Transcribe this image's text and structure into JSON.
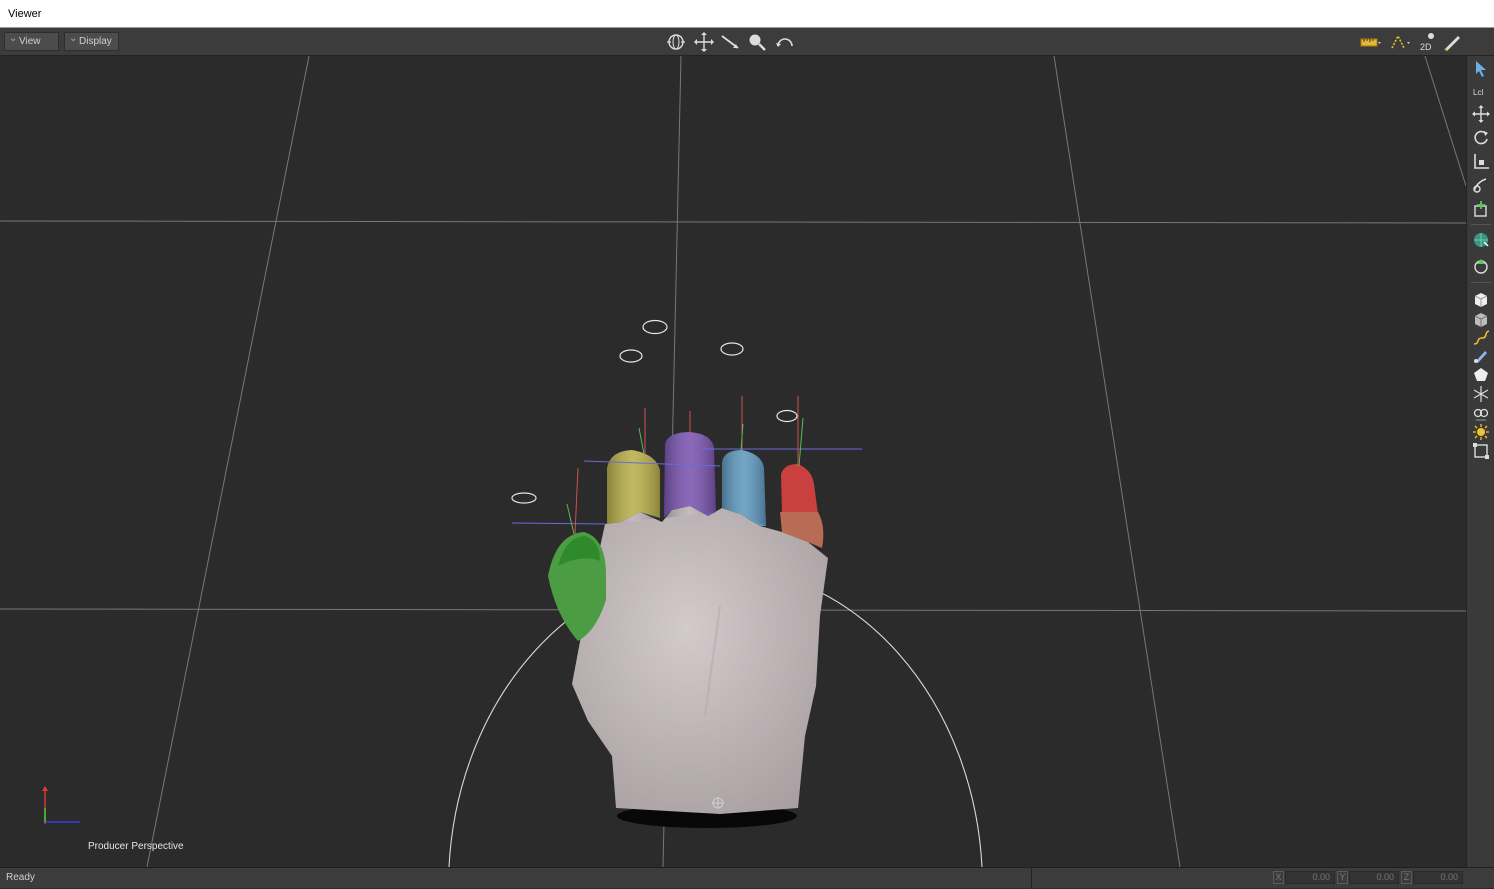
{
  "window": {
    "title": "Viewer"
  },
  "menus": {
    "view_label": "View",
    "display_label": "Display"
  },
  "toolbar": {
    "center_icons": [
      "orbit-icon",
      "pan-icon",
      "dolly-icon",
      "zoom-icon",
      "undo-view-icon"
    ],
    "right_icons": [
      "ruler-icon",
      "curve-icon",
      "2d-icon",
      "edit-icon"
    ],
    "mode_2d_label": "2D"
  },
  "side_toolbar": {
    "icons": [
      "select-icon",
      "local-icon",
      "translate-icon",
      "rotate-icon",
      "scale-icon",
      "rig-icon",
      "add-icon",
      "globe-icon",
      "snap-icon",
      "cube-icon",
      "cube-alt-icon",
      "path-icon",
      "brush-icon",
      "shape-icon",
      "marker-icon",
      "eye-icon",
      "sun-icon",
      "frame-icon"
    ],
    "local_label": "Lcl"
  },
  "viewport": {
    "camera_label": "Producer Perspective"
  },
  "status": {
    "text": "Ready",
    "x_label": "X",
    "x_value": "0.00",
    "y_label": "Y",
    "y_value": "0.00",
    "z_label": "Z",
    "z_value": "0.00"
  },
  "colors": {
    "background": "#2b2b2b",
    "hand": "#c6bcbe",
    "thumb": "#4fa044",
    "index": "#b8ae4a",
    "middle": "#7a55b0",
    "ring": "#5f98bf",
    "pinky": "#c9403f"
  }
}
